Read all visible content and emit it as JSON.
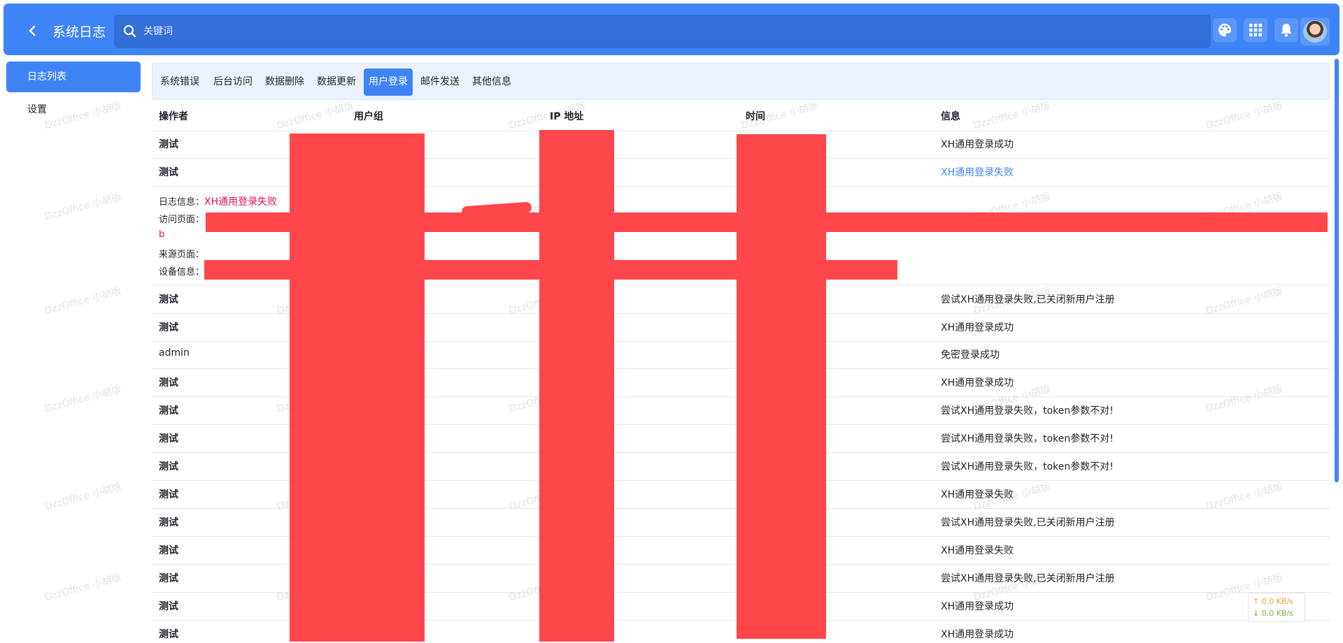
{
  "header": {
    "back_icon": "chevron-left-icon",
    "title": "系统日志",
    "search_placeholder": "关键词",
    "icons": [
      "palette-icon",
      "apps-grid-icon",
      "bell-icon",
      "avatar"
    ]
  },
  "sidebar": {
    "items": [
      {
        "label": "日志列表",
        "active": true
      },
      {
        "label": "设置",
        "active": false
      }
    ]
  },
  "tabs": [
    {
      "label": "系统错误"
    },
    {
      "label": "后台访问"
    },
    {
      "label": "数据删除"
    },
    {
      "label": "数据更新"
    },
    {
      "label": "用户登录",
      "active": true
    },
    {
      "label": "邮件发送"
    },
    {
      "label": "其他信息"
    }
  ],
  "table": {
    "headers": [
      "操作者",
      "用户组",
      "IP 地址",
      "时间",
      "信息"
    ],
    "rows": [
      {
        "operator": "测试",
        "info": "XH通用登录成功"
      },
      {
        "operator": "测试",
        "info": "XH通用登录失败",
        "info_link": true
      },
      {
        "operator": "测试",
        "info": "尝试XH通用登录失败,已关闭新用户注册"
      },
      {
        "operator": "测试",
        "info": "XH通用登录成功"
      },
      {
        "operator": "admin",
        "info": "免密登录成功"
      },
      {
        "operator": "测试",
        "info": "XH通用登录成功"
      },
      {
        "operator": "测试",
        "info": "尝试XH通用登录失败，token参数不对!"
      },
      {
        "operator": "测试",
        "info": "尝试XH通用登录失败，token参数不对!"
      },
      {
        "operator": "测试",
        "info": "尝试XH通用登录失败，token参数不对!"
      },
      {
        "operator": "测试",
        "info": "XH通用登录失败"
      },
      {
        "operator": "测试",
        "info": "尝试XH通用登录失败,已关闭新用户注册"
      },
      {
        "operator": "测试",
        "info": "XH通用登录失败"
      },
      {
        "operator": "测试",
        "info": "尝试XH通用登录失败,已关闭新用户注册"
      },
      {
        "operator": "测试",
        "info": "XH通用登录成功"
      },
      {
        "operator": "测试",
        "info": "XH通用登录成功"
      }
    ],
    "detail": {
      "log_info_label": "日志信息：",
      "log_info_value": "XH通用登录失败",
      "visit_page_label": "访问页面：",
      "visit_page_value": "b",
      "source_page_label": "来源页面：",
      "device_info_label": "设备信息："
    }
  },
  "watermark": "DzzOffice 小胡版",
  "speed_widget": {
    "up": "↑ 0.0 KB/s",
    "down": "↓ 0.0 KB/s"
  },
  "colors": {
    "primary": "#3f84f5",
    "redaction": "#ff464b",
    "detail_value": "#e01060"
  }
}
